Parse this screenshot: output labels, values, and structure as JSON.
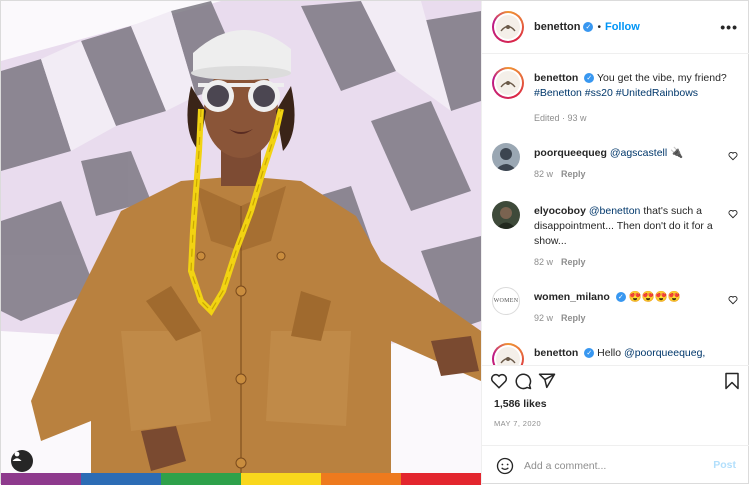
{
  "post": {
    "username": "benetton",
    "follow_label": "Follow",
    "separator": "•",
    "more_label": "•••",
    "logo_text": "ucb"
  },
  "caption": {
    "username": "benetton",
    "text": "You get the vibe, my friend?",
    "hashtags": "#Benetton #ss20 #UnitedRainbows",
    "meta": "Edited · 93 w"
  },
  "comments": [
    {
      "username": "poorqueequeg",
      "mention": "@agscastell",
      "text": "🔌",
      "time": "82 w",
      "reply": "Reply"
    },
    {
      "username": "elyocoboy",
      "mention": "@benetton",
      "text": "that's such a disappointment... Then don't do it for a show...",
      "time": "82 w",
      "reply": "Reply"
    },
    {
      "username": "women_milano",
      "text": "😍😍😍😍",
      "time": "92 w",
      "reply": "Reply",
      "avatar_text": "WOMEN"
    },
    {
      "username": "benetton",
      "text": "Hello",
      "mention": "@poorqueequeg,"
    }
  ],
  "engagement": {
    "likes": "1,586 likes",
    "date": "MAY 7, 2020"
  },
  "add_comment": {
    "placeholder": "Add a comment...",
    "post_label": "Post"
  },
  "colors": {
    "accent": "#0095f6",
    "verified": "#3897f0",
    "rainbow": [
      "#8e3a8d",
      "#2c6cb5",
      "#2ea14a",
      "#f9d71c",
      "#ee7a1e",
      "#e3262e"
    ]
  },
  "icons": [
    "heart-icon",
    "comment-icon",
    "share-icon",
    "bookmark-icon",
    "emoji-icon",
    "user-tag-icon",
    "verified-icon",
    "more-icon"
  ]
}
